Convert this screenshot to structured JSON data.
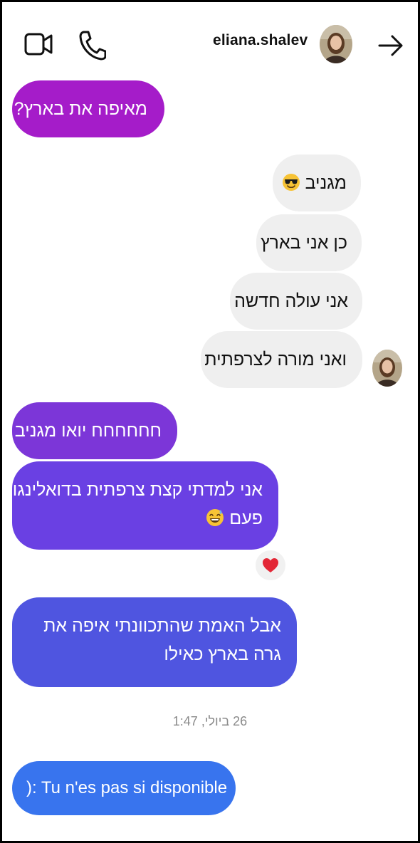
{
  "header": {
    "username": "eliana.shalev",
    "icons": [
      "video-camera-icon",
      "phone-icon",
      "arrow-right-icon"
    ]
  },
  "messages": [
    {
      "side": "left",
      "text": "מאיפה את בארץ?"
    },
    {
      "side": "right",
      "text": "מגניב",
      "emoji": "smiling-face-with-sunglasses"
    },
    {
      "side": "right",
      "text": "כן אני בארץ"
    },
    {
      "side": "right",
      "text": "אני עולה חדשה"
    },
    {
      "side": "right",
      "text": "ואני מורה לצרפתית"
    },
    {
      "side": "left",
      "text": "חחחחחח יואו מגניב"
    },
    {
      "side": "left",
      "text": "אני למדתי קצת צרפתית בדואלינגו פעם",
      "emoji": "grinning-face-with-sweat",
      "reaction": "red-heart"
    },
    {
      "side": "left",
      "text": "אבל האמת שהתכוונתי איפה את גרה בארץ כאילו"
    },
    {
      "side": "left",
      "text": "): Tu n'es pas si disponible"
    }
  ],
  "timestamp": "26 ביולי, 1:47",
  "colors": {
    "bubble_magenta": "#a51cc9",
    "bubble_violet": "#7c36d8",
    "bubble_indigo": "#6a40e3",
    "bubble_blue": "#4f55e0",
    "bubble_bright_blue": "#3874ee",
    "bubble_grey": "#efefef"
  }
}
